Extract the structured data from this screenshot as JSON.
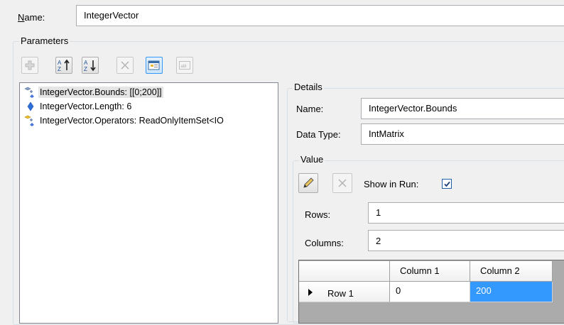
{
  "name_field": {
    "label": "Name:",
    "value": "IntegerVector"
  },
  "parameters": {
    "title": "Parameters",
    "toolbar": [
      {
        "icon": "add-icon",
        "enabled": false
      },
      {
        "icon": "sort-ascending-icon",
        "enabled": true
      },
      {
        "icon": "sort-descending-icon",
        "enabled": true
      },
      {
        "icon": "remove-icon",
        "enabled": false
      },
      {
        "icon": "properties-icon",
        "enabled": true,
        "pressed": true
      },
      {
        "icon": "text-icon",
        "enabled": false
      }
    ],
    "items": [
      {
        "label": "IntegerVector.Bounds: [[0;200]]",
        "icon": "value-parameter-icon",
        "selected": true
      },
      {
        "label": "IntegerVector.Length: 6",
        "icon": "blue-gem-icon",
        "selected": false
      },
      {
        "label": "IntegerVector.Operators: ReadOnlyItemSet<IO",
        "icon": "operators-parameter-icon",
        "selected": false
      }
    ]
  },
  "details": {
    "title": "Details",
    "name_label": "Name:",
    "name_value": "IntegerVector.Bounds",
    "datatype_label": "Data Type:",
    "datatype_value": "IntMatrix",
    "value_group": {
      "title": "Value",
      "show_in_run_label": "Show in Run:",
      "show_in_run_checked": true,
      "rows_label": "Rows:",
      "rows_value": "1",
      "columns_label": "Columns:",
      "columns_value": "2",
      "grid": {
        "columns": [
          "Column 1",
          "Column 2"
        ],
        "rows": [
          {
            "header": "Row 1",
            "cells": [
              "0",
              "200"
            ]
          }
        ]
      }
    }
  },
  "colors": {
    "selection": "#3399ff",
    "group_border": "#d5dfe5",
    "selected_item_bg": "#e5e5e5"
  }
}
